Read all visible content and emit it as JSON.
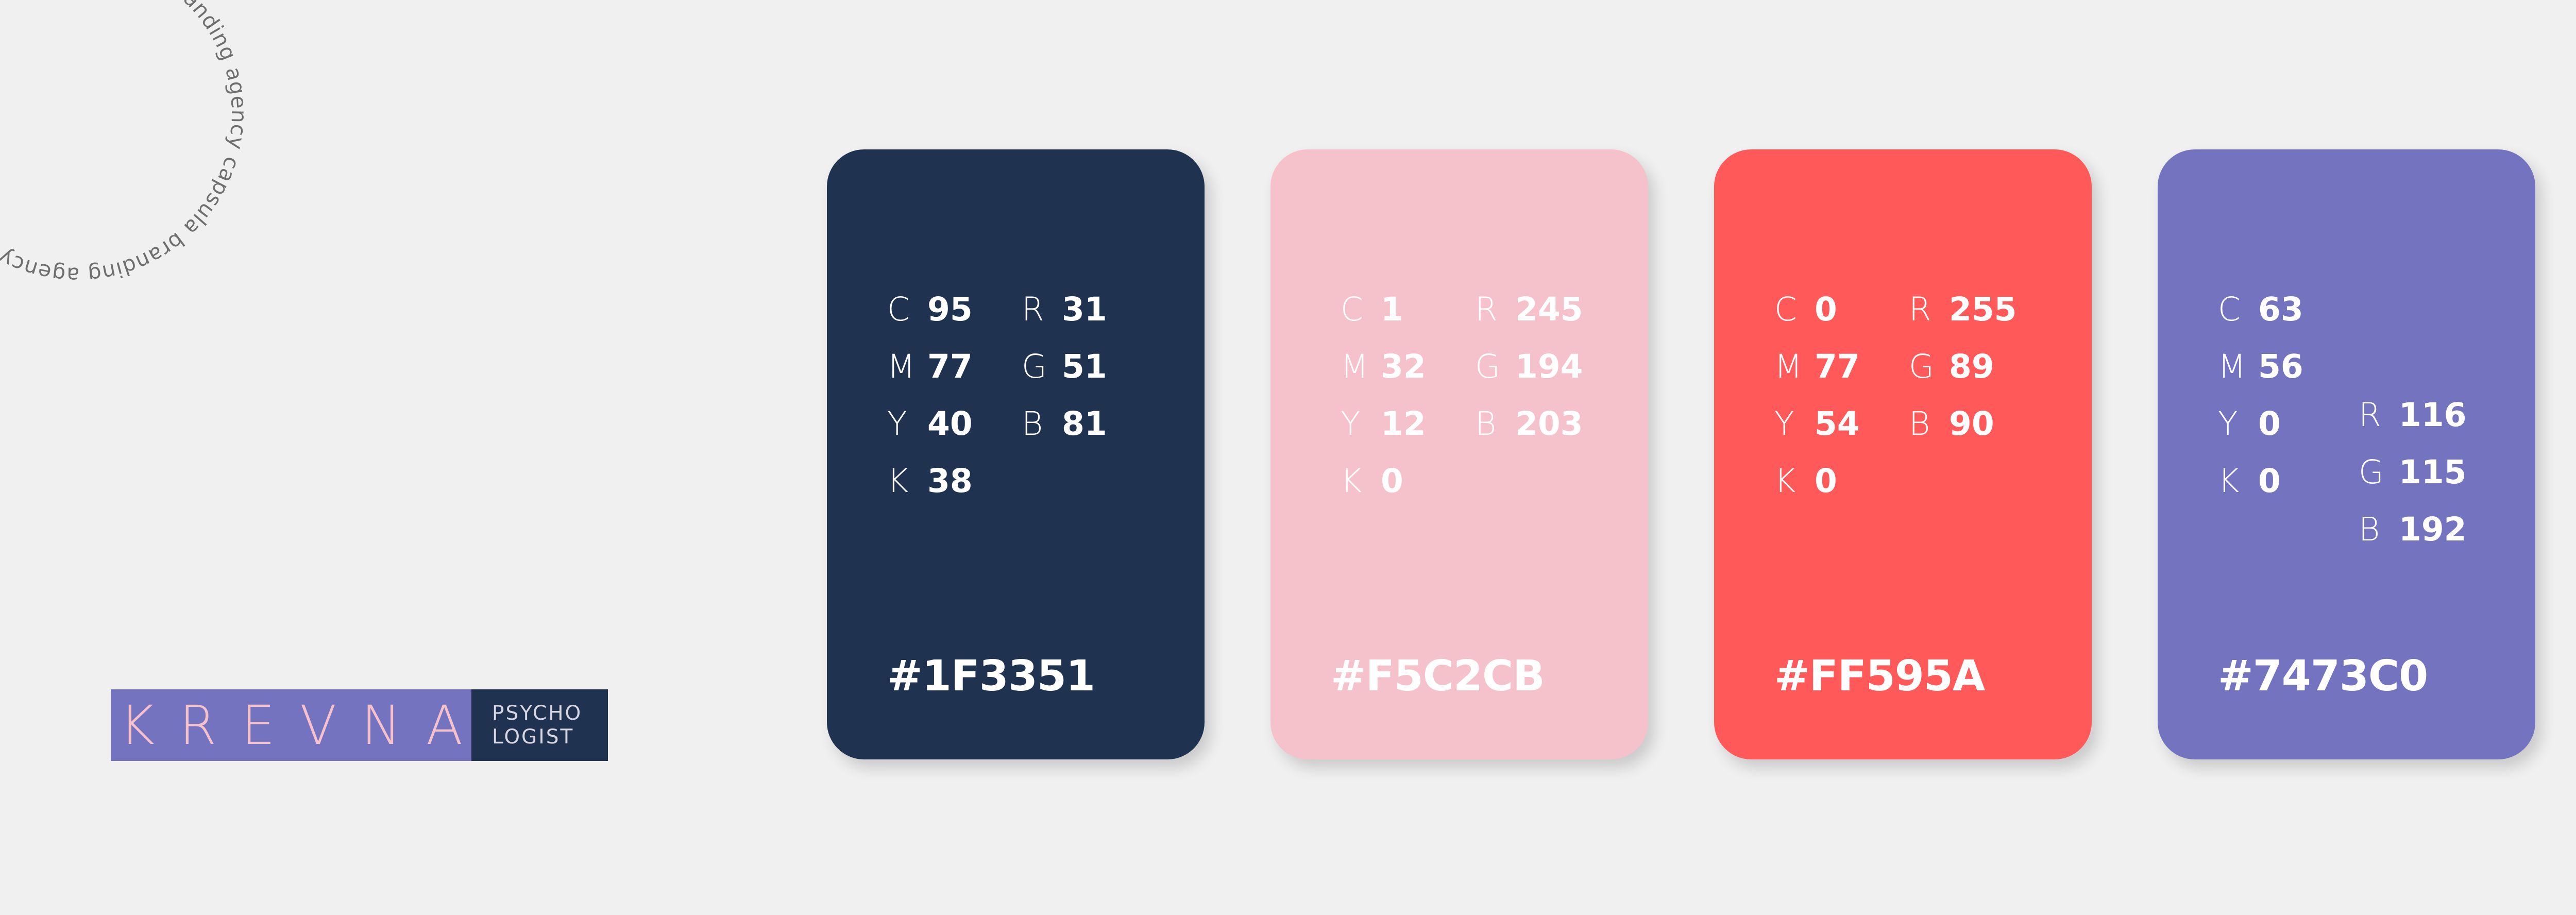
{
  "ring_text": "capsula branding agency  capsula branding agency  capsula branding agency",
  "logo": {
    "name": "KREVNA",
    "side_line1": "PSYCHO",
    "side_line2": "LOGIST"
  },
  "swatches": [
    {
      "hex": "#1F3351",
      "color": "#1F3351",
      "c_label": "C",
      "c": "95",
      "m_label": "M",
      "m": "77",
      "y_label": "Y",
      "y": "40",
      "k_label": "K",
      "k": "38",
      "r_label": "R",
      "r": "31",
      "g_label": "G",
      "g": "51",
      "b_label": "B",
      "b": "81"
    },
    {
      "hex": "#F5C2CB",
      "color": "#F5C2CB",
      "c_label": "C",
      "c": "1",
      "m_label": "M",
      "m": "32",
      "y_label": "Y",
      "y": "12",
      "k_label": "K",
      "k": "0",
      "r_label": "R",
      "r": "245",
      "g_label": "G",
      "g": "194",
      "b_label": "B",
      "b": "203"
    },
    {
      "hex": "#FF595A",
      "color": "#FF595A",
      "c_label": "C",
      "c": "0",
      "m_label": "M",
      "m": "77",
      "y_label": "Y",
      "y": "54",
      "k_label": "K",
      "k": "0",
      "r_label": "R",
      "r": "255",
      "g_label": "G",
      "g": "89",
      "b_label": "B",
      "b": "90"
    },
    {
      "hex": "#7473C0",
      "color": "#7473C0",
      "c_label": "C",
      "c": "63",
      "m_label": "M",
      "m": "56",
      "y_label": "Y",
      "y": "0",
      "k_label": "K",
      "k": "0",
      "r_label": "R",
      "r": "116",
      "g_label": "G",
      "g": "115",
      "b_label": "B",
      "b": "192"
    }
  ]
}
